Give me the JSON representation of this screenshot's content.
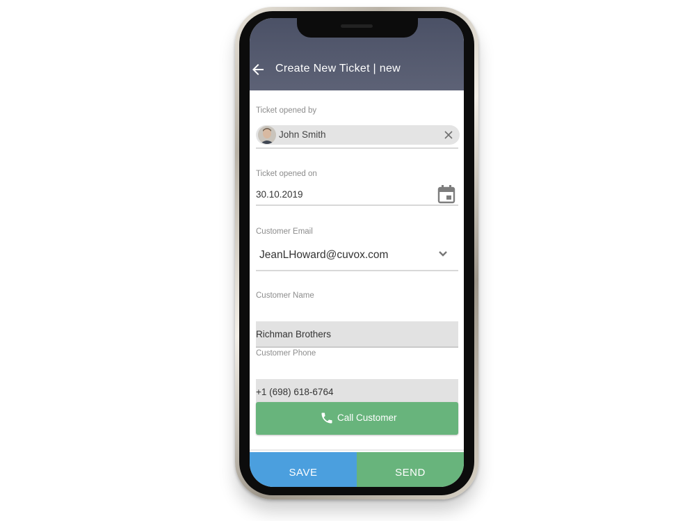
{
  "appbar": {
    "title": "Create New Ticket | new",
    "back_icon": "arrow-left-icon"
  },
  "form": {
    "opened_by": {
      "label": "Ticket opened by",
      "value": "John Smith",
      "clear_icon": "close-icon"
    },
    "opened_on": {
      "label": "Ticket opened on",
      "value": "30.10.2019",
      "icon": "calendar-icon"
    },
    "customer_email": {
      "label": "Customer Email",
      "value": "JeanLHoward@cuvox.com",
      "icon": "chevron-down-icon"
    },
    "customer_name": {
      "label": "Customer Name",
      "value": "Richman Brothers"
    },
    "customer_phone": {
      "label": "Customer Phone",
      "value": "+1 (698) 618-6764"
    },
    "call_button": {
      "label": "Call Customer",
      "icon": "phone-icon"
    }
  },
  "actions": {
    "save_label": "SAVE",
    "send_label": "SEND"
  },
  "colors": {
    "appbar": "#555a6e",
    "save": "#4b9fde",
    "send": "#68b47c",
    "call": "#68b47c"
  }
}
